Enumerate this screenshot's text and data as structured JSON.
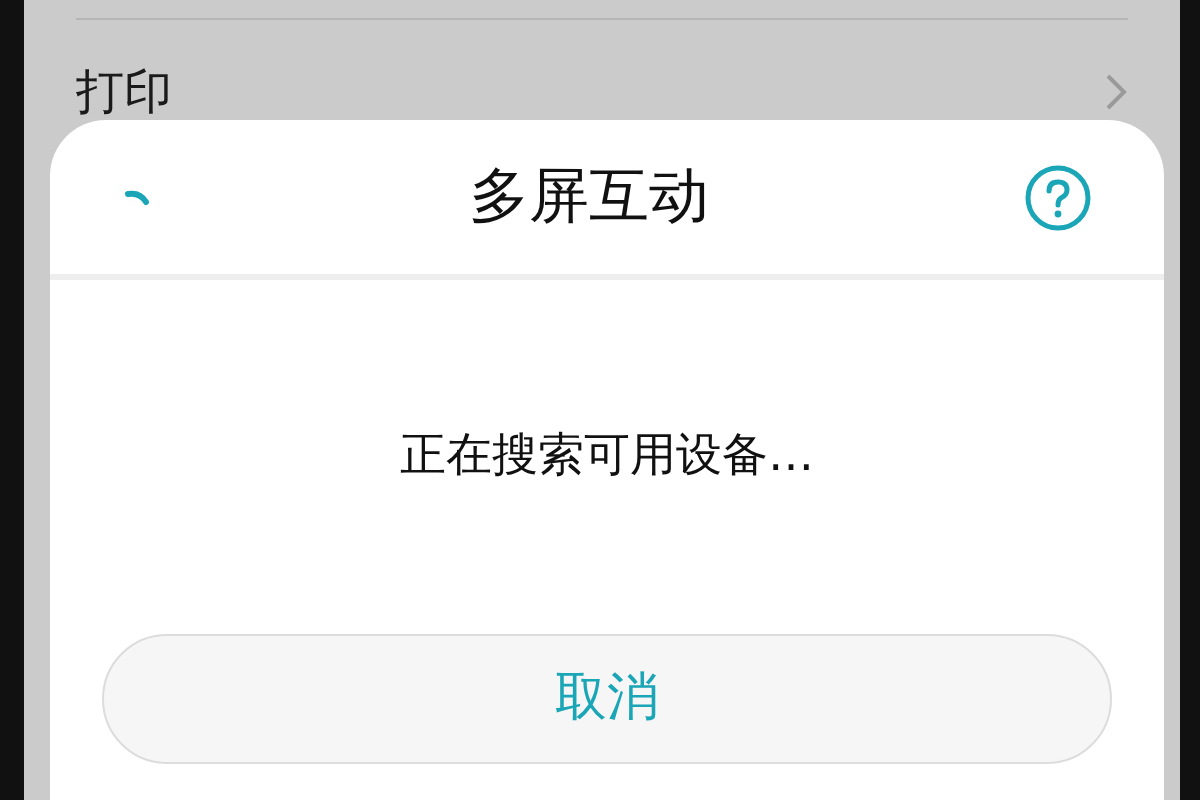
{
  "background_list": {
    "items": [
      {
        "label": "打印"
      }
    ]
  },
  "dialog": {
    "title": "多屏互动",
    "message": "正在搜索可用设备…",
    "buttons": [
      "取消"
    ]
  }
}
